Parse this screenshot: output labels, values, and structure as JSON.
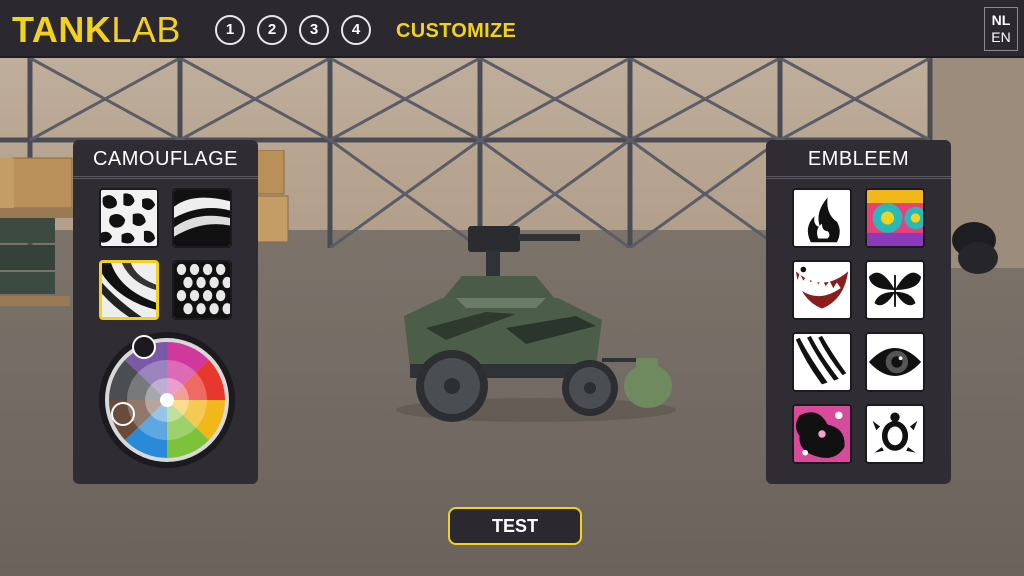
{
  "header": {
    "logo_bold": "TANK",
    "logo_light": "LAB",
    "steps": [
      "1",
      "2",
      "3",
      "4"
    ],
    "current_step_label": "CUSTOMIZE",
    "lang_options": [
      "NL",
      "EN"
    ]
  },
  "camouflage_panel": {
    "title": "CAMOUFLAGE",
    "patterns": [
      {
        "id": "spots",
        "selected": false
      },
      {
        "id": "waves",
        "selected": false
      },
      {
        "id": "stripes",
        "selected": true
      },
      {
        "id": "scales",
        "selected": false
      }
    ],
    "color_wheel_icon": "color-wheel"
  },
  "emblem_panel": {
    "title": "EMBLEEM",
    "emblems": [
      "flame-emblem",
      "psychedelic-eyes-emblem",
      "shark-teeth-emblem",
      "butterfly-emblem",
      "claw-scratch-emblem",
      "eye-emblem",
      "splatter-emblem",
      "turtle-emblem"
    ]
  },
  "actions": {
    "test_label": "TEST"
  },
  "colors": {
    "accent": "#f2d21b",
    "panel": "#2f2c33",
    "topbar": "#2b2830"
  }
}
